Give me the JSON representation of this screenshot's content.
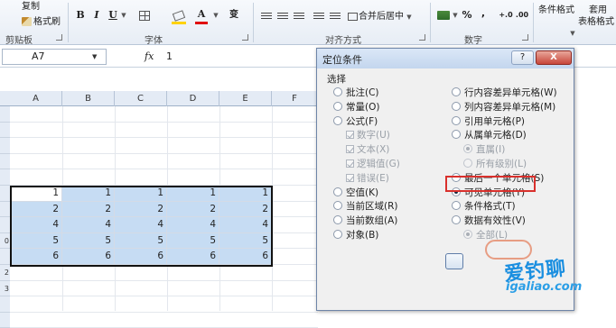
{
  "ribbon": {
    "clipboard": {
      "copy_label": "复制",
      "format_painter_label": "格式刷",
      "group_label": "剪贴板"
    },
    "font": {
      "group_label": "字体"
    },
    "alignment": {
      "merge_center_label": "合并后居中",
      "group_label": "对齐方式"
    },
    "number": {
      "percent": "%",
      "comma": ",",
      "group_label": "数字"
    },
    "styles": {
      "conditional_format_label": "条件格式",
      "apply_label": "套用",
      "table_format_label": "表格格式"
    }
  },
  "formula_bar": {
    "name_box": "A7",
    "fx": "fx",
    "value": "1"
  },
  "sheet": {
    "columns": [
      "A",
      "B",
      "C",
      "D",
      "E",
      "F"
    ],
    "row_headers": [
      "",
      "",
      "",
      "",
      "",
      "",
      "",
      "",
      "0",
      "",
      "2",
      "3",
      "",
      ""
    ],
    "data_rows": [
      [
        "1",
        "1",
        "1",
        "1",
        "1"
      ],
      [
        "2",
        "2",
        "2",
        "2",
        "2"
      ],
      [
        "4",
        "4",
        "4",
        "4",
        "4"
      ],
      [
        "5",
        "5",
        "5",
        "5",
        "5"
      ],
      [
        "6",
        "6",
        "6",
        "6",
        "6"
      ]
    ]
  },
  "dialog": {
    "title": "定位条件",
    "help": "?",
    "close": "X",
    "section_label": "选择",
    "left_options": [
      {
        "label": "批注(C)",
        "selected": false
      },
      {
        "label": "常量(O)",
        "selected": false
      },
      {
        "label": "公式(F)",
        "selected": false
      },
      {
        "label": "数字(U)",
        "sub": true
      },
      {
        "label": "文本(X)",
        "sub": true
      },
      {
        "label": "逻辑值(G)",
        "sub": true
      },
      {
        "label": "错误(E)",
        "sub": true
      },
      {
        "label": "空值(K)",
        "selected": false
      },
      {
        "label": "当前区域(R)",
        "selected": false
      },
      {
        "label": "当前数组(A)",
        "selected": false
      },
      {
        "label": "对象(B)",
        "selected": false
      }
    ],
    "right_options": [
      {
        "label": "行内容差异单元格(W)",
        "selected": false
      },
      {
        "label": "列内容差异单元格(M)",
        "selected": false
      },
      {
        "label": "引用单元格(P)",
        "selected": false
      },
      {
        "label": "从属单元格(D)",
        "selected": false
      },
      {
        "label": "直属(I)",
        "sub": true,
        "selected": true
      },
      {
        "label": "所有级别(L)",
        "sub": true,
        "selected": false
      },
      {
        "label": "最后一个单元格(S)",
        "selected": false
      },
      {
        "label": "可见单元格(Y)",
        "selected": true
      },
      {
        "label": "条件格式(T)",
        "selected": false
      },
      {
        "label": "数据有效性(V)",
        "selected": false
      },
      {
        "label": "全部(L)",
        "sub": true,
        "selected": true
      }
    ],
    "highlight_color": "#d9302c"
  },
  "watermark": {
    "text": "爱钓聊",
    "url": "igaliao.com"
  }
}
